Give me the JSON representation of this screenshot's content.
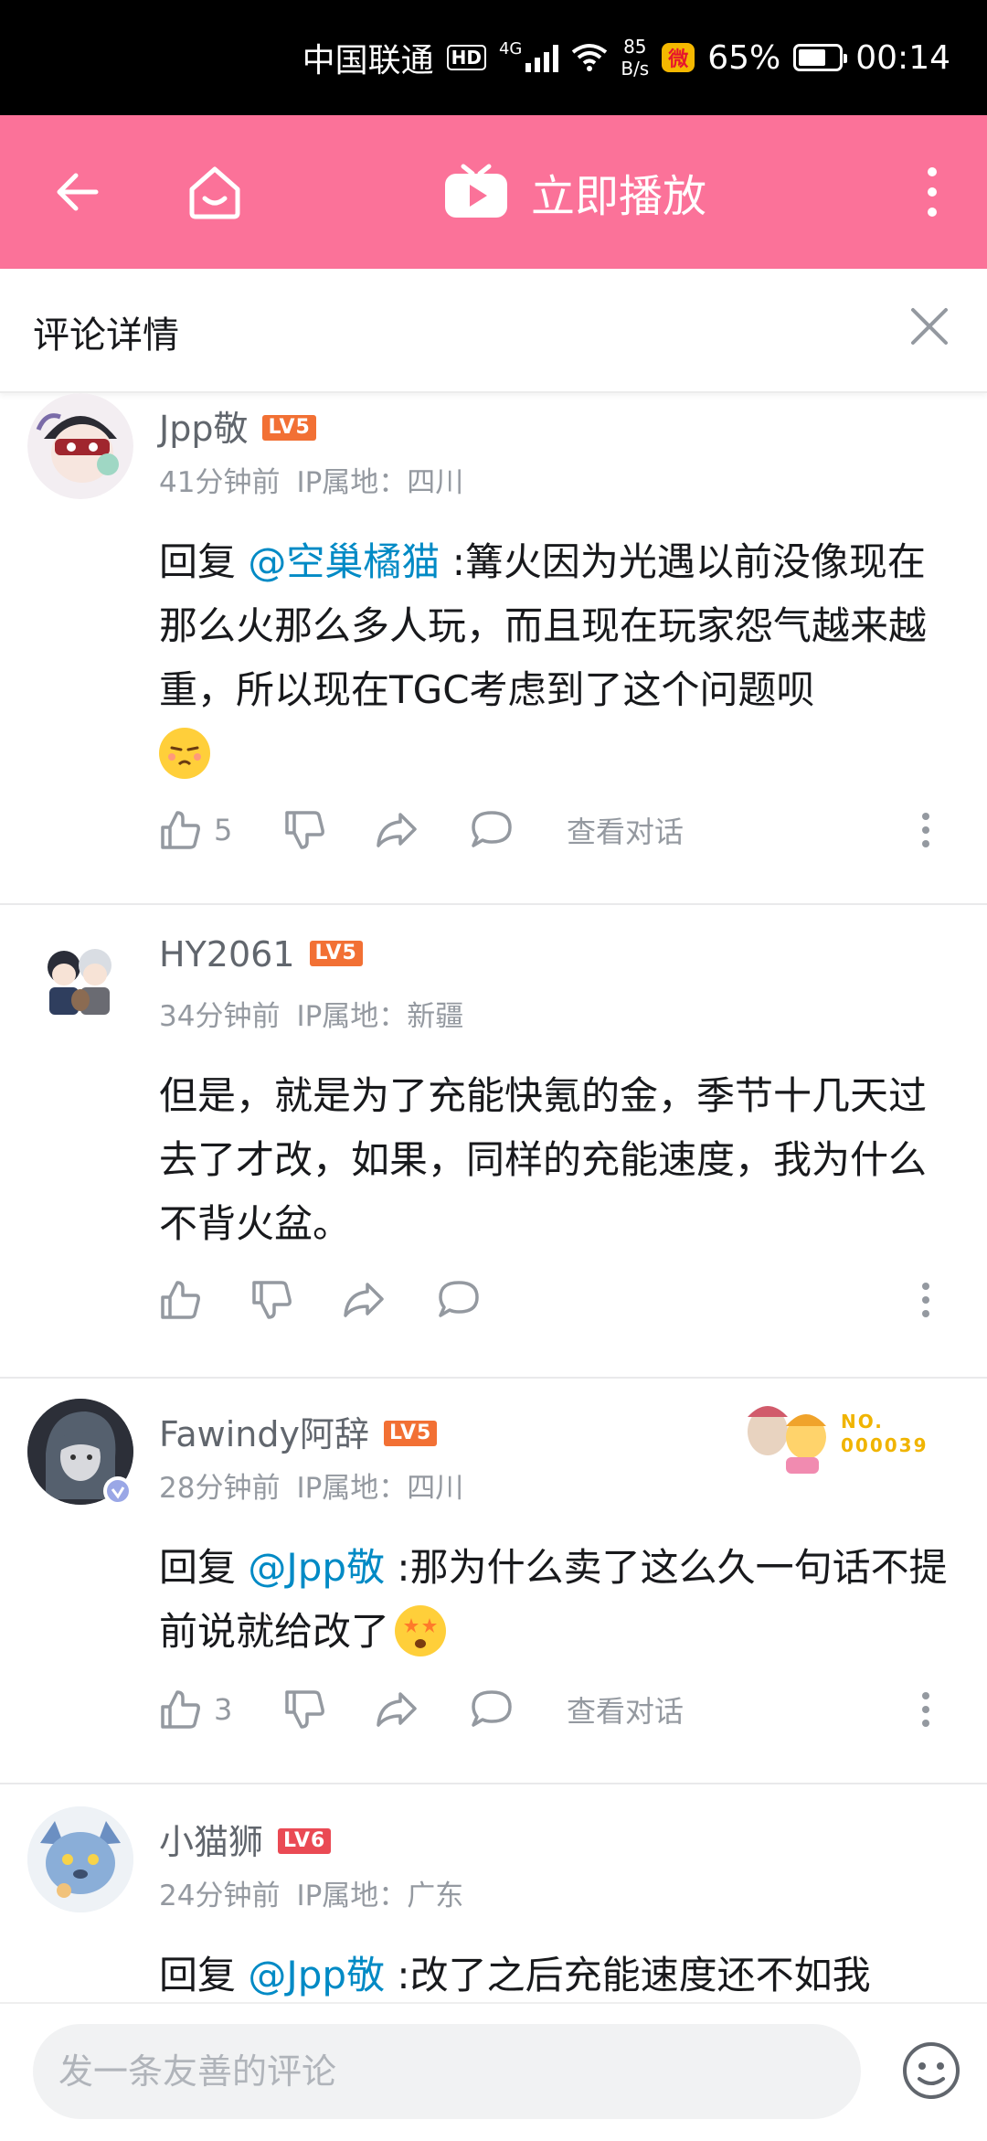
{
  "status_bar": {
    "carrier": "中国联通",
    "hd": "HD",
    "network": "4G",
    "speed_value": "85",
    "speed_unit": "B/s",
    "battery": "65%",
    "time": "00:14"
  },
  "app_bar": {
    "play_label": "立即播放",
    "accent_color": "#fb7299"
  },
  "detail": {
    "title": "评论详情"
  },
  "comments": [
    {
      "username": "Jpp敬",
      "level": "LV5",
      "time": "41分钟前",
      "ip": "IP属地：四川",
      "reply_prefix": "回复 ",
      "mention": "@空巢橘猫",
      "text": " :篝火因为光遇以前没像现在那么火那么多人玩，而且现在玩家怨气越来越重，所以现在TGC考虑到了这个问题呗",
      "emoji": "sulky-face-emoji",
      "likes": "5",
      "view_dialog": "查看对话"
    },
    {
      "username": "HY2061",
      "level": "LV5",
      "time": "34分钟前",
      "ip": "IP属地：新疆",
      "text": "但是，就是为了充能快氪的金，季节十几天过去了才改，如果，同样的充能速度，我为什么不背火盆。",
      "likes": ""
    },
    {
      "username": "Fawindy阿辞",
      "level": "LV5",
      "time": "28分钟前",
      "ip": "IP属地：四川",
      "reply_prefix": "回复 ",
      "mention": "@Jpp敬",
      "text": " :那为什么卖了这么久一句话不提前说就给改了",
      "emoji": "starry-eyed-emoji",
      "likes": "3",
      "view_dialog": "查看对话",
      "fan_number": "NO.\n000039"
    },
    {
      "username": "小猫狮",
      "level": "LV6",
      "time": "24分钟前",
      "ip": "IP属地：广东",
      "reply_prefix": "回复 ",
      "mention": "@Jpp敬",
      "text": " :改了之后充能速度还不如我"
    }
  ],
  "input": {
    "placeholder": "发一条友善的评论"
  },
  "colors": {
    "lv5": "#f27034",
    "lv6": "#ea4a54",
    "mention": "#008ac5"
  }
}
